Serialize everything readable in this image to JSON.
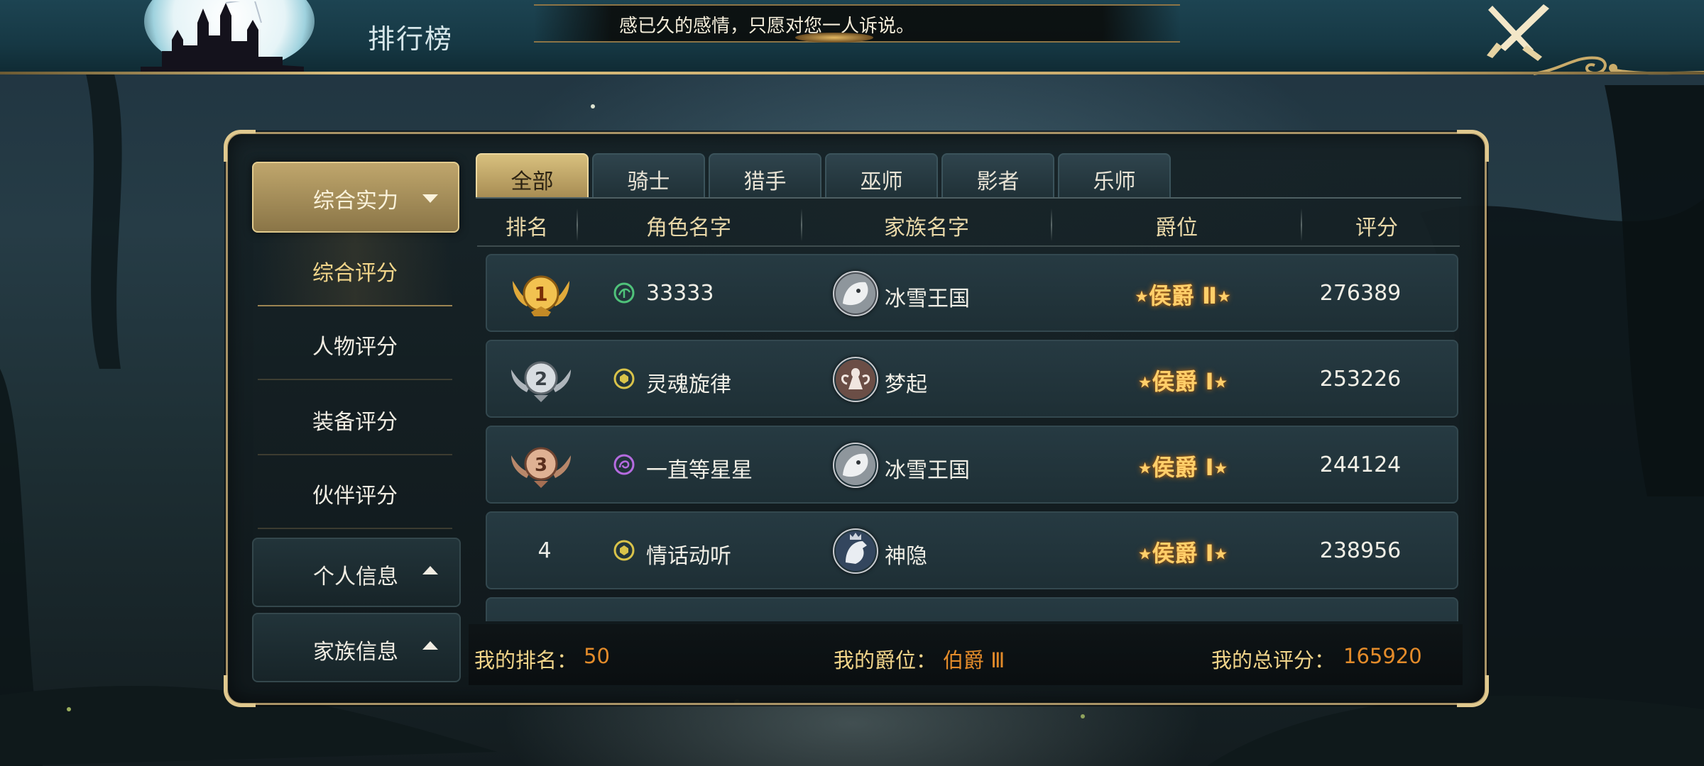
{
  "header": {
    "page_title": "排行榜",
    "marquee_text": "感已久的感情，只愿对您一人诉说。"
  },
  "sidebar": {
    "main_category": "综合实力",
    "items": [
      {
        "label": "综合评分",
        "active": true
      },
      {
        "label": "人物评分",
        "active": false
      },
      {
        "label": "装备评分",
        "active": false
      },
      {
        "label": "伙伴评分",
        "active": false
      }
    ],
    "groups": [
      {
        "label": "个人信息"
      },
      {
        "label": "家族信息"
      }
    ]
  },
  "tabs": [
    {
      "label": "全部",
      "active": true
    },
    {
      "label": "骑士",
      "active": false
    },
    {
      "label": "猎手",
      "active": false
    },
    {
      "label": "巫师",
      "active": false
    },
    {
      "label": "影者",
      "active": false
    },
    {
      "label": "乐师",
      "active": false
    }
  ],
  "table": {
    "columns": [
      "排名",
      "角色名字",
      "家族名字",
      "爵位",
      "评分"
    ],
    "rows": [
      {
        "rank": "1",
        "medal": "gold-medal-icon",
        "class_icon": "hunter-class-icon",
        "class_color": "#4fc27a",
        "name": "33333",
        "family": "冰雪王国",
        "family_avatar": "white-beast-avatar",
        "title": "侯爵 Ⅱ",
        "score": "276389"
      },
      {
        "rank": "2",
        "medal": "silver-medal-icon",
        "class_icon": "knight-class-icon",
        "class_color": "#d9c34a",
        "name": "灵魂旋律",
        "family": "梦起",
        "family_avatar": "fairy-avatar",
        "title": "侯爵 Ⅰ",
        "score": "253226"
      },
      {
        "rank": "3",
        "medal": "bronze-medal-icon",
        "class_icon": "wizard-class-icon",
        "class_color": "#b56be0",
        "name": "一直等星星",
        "family": "冰雪王国",
        "family_avatar": "white-beast-avatar",
        "title": "侯爵 Ⅰ",
        "score": "244124"
      },
      {
        "rank": "4",
        "medal": "",
        "class_icon": "knight-class-icon",
        "class_color": "#d9c34a",
        "name": "情话动听",
        "family": "神隐",
        "family_avatar": "griffin-avatar",
        "title": "侯爵 Ⅰ",
        "score": "238956"
      }
    ]
  },
  "footer": {
    "my_rank_label": "我的排名：",
    "my_rank_value": "50",
    "my_title_label": "我的爵位：",
    "my_title_value": "伯爵 Ⅲ",
    "my_score_label": "我的总评分：",
    "my_score_value": "165920"
  },
  "colors": {
    "accent_gold": "#e3cc8e",
    "title_orange": "#ffcf6a",
    "footer_value": "#e38b2a"
  }
}
